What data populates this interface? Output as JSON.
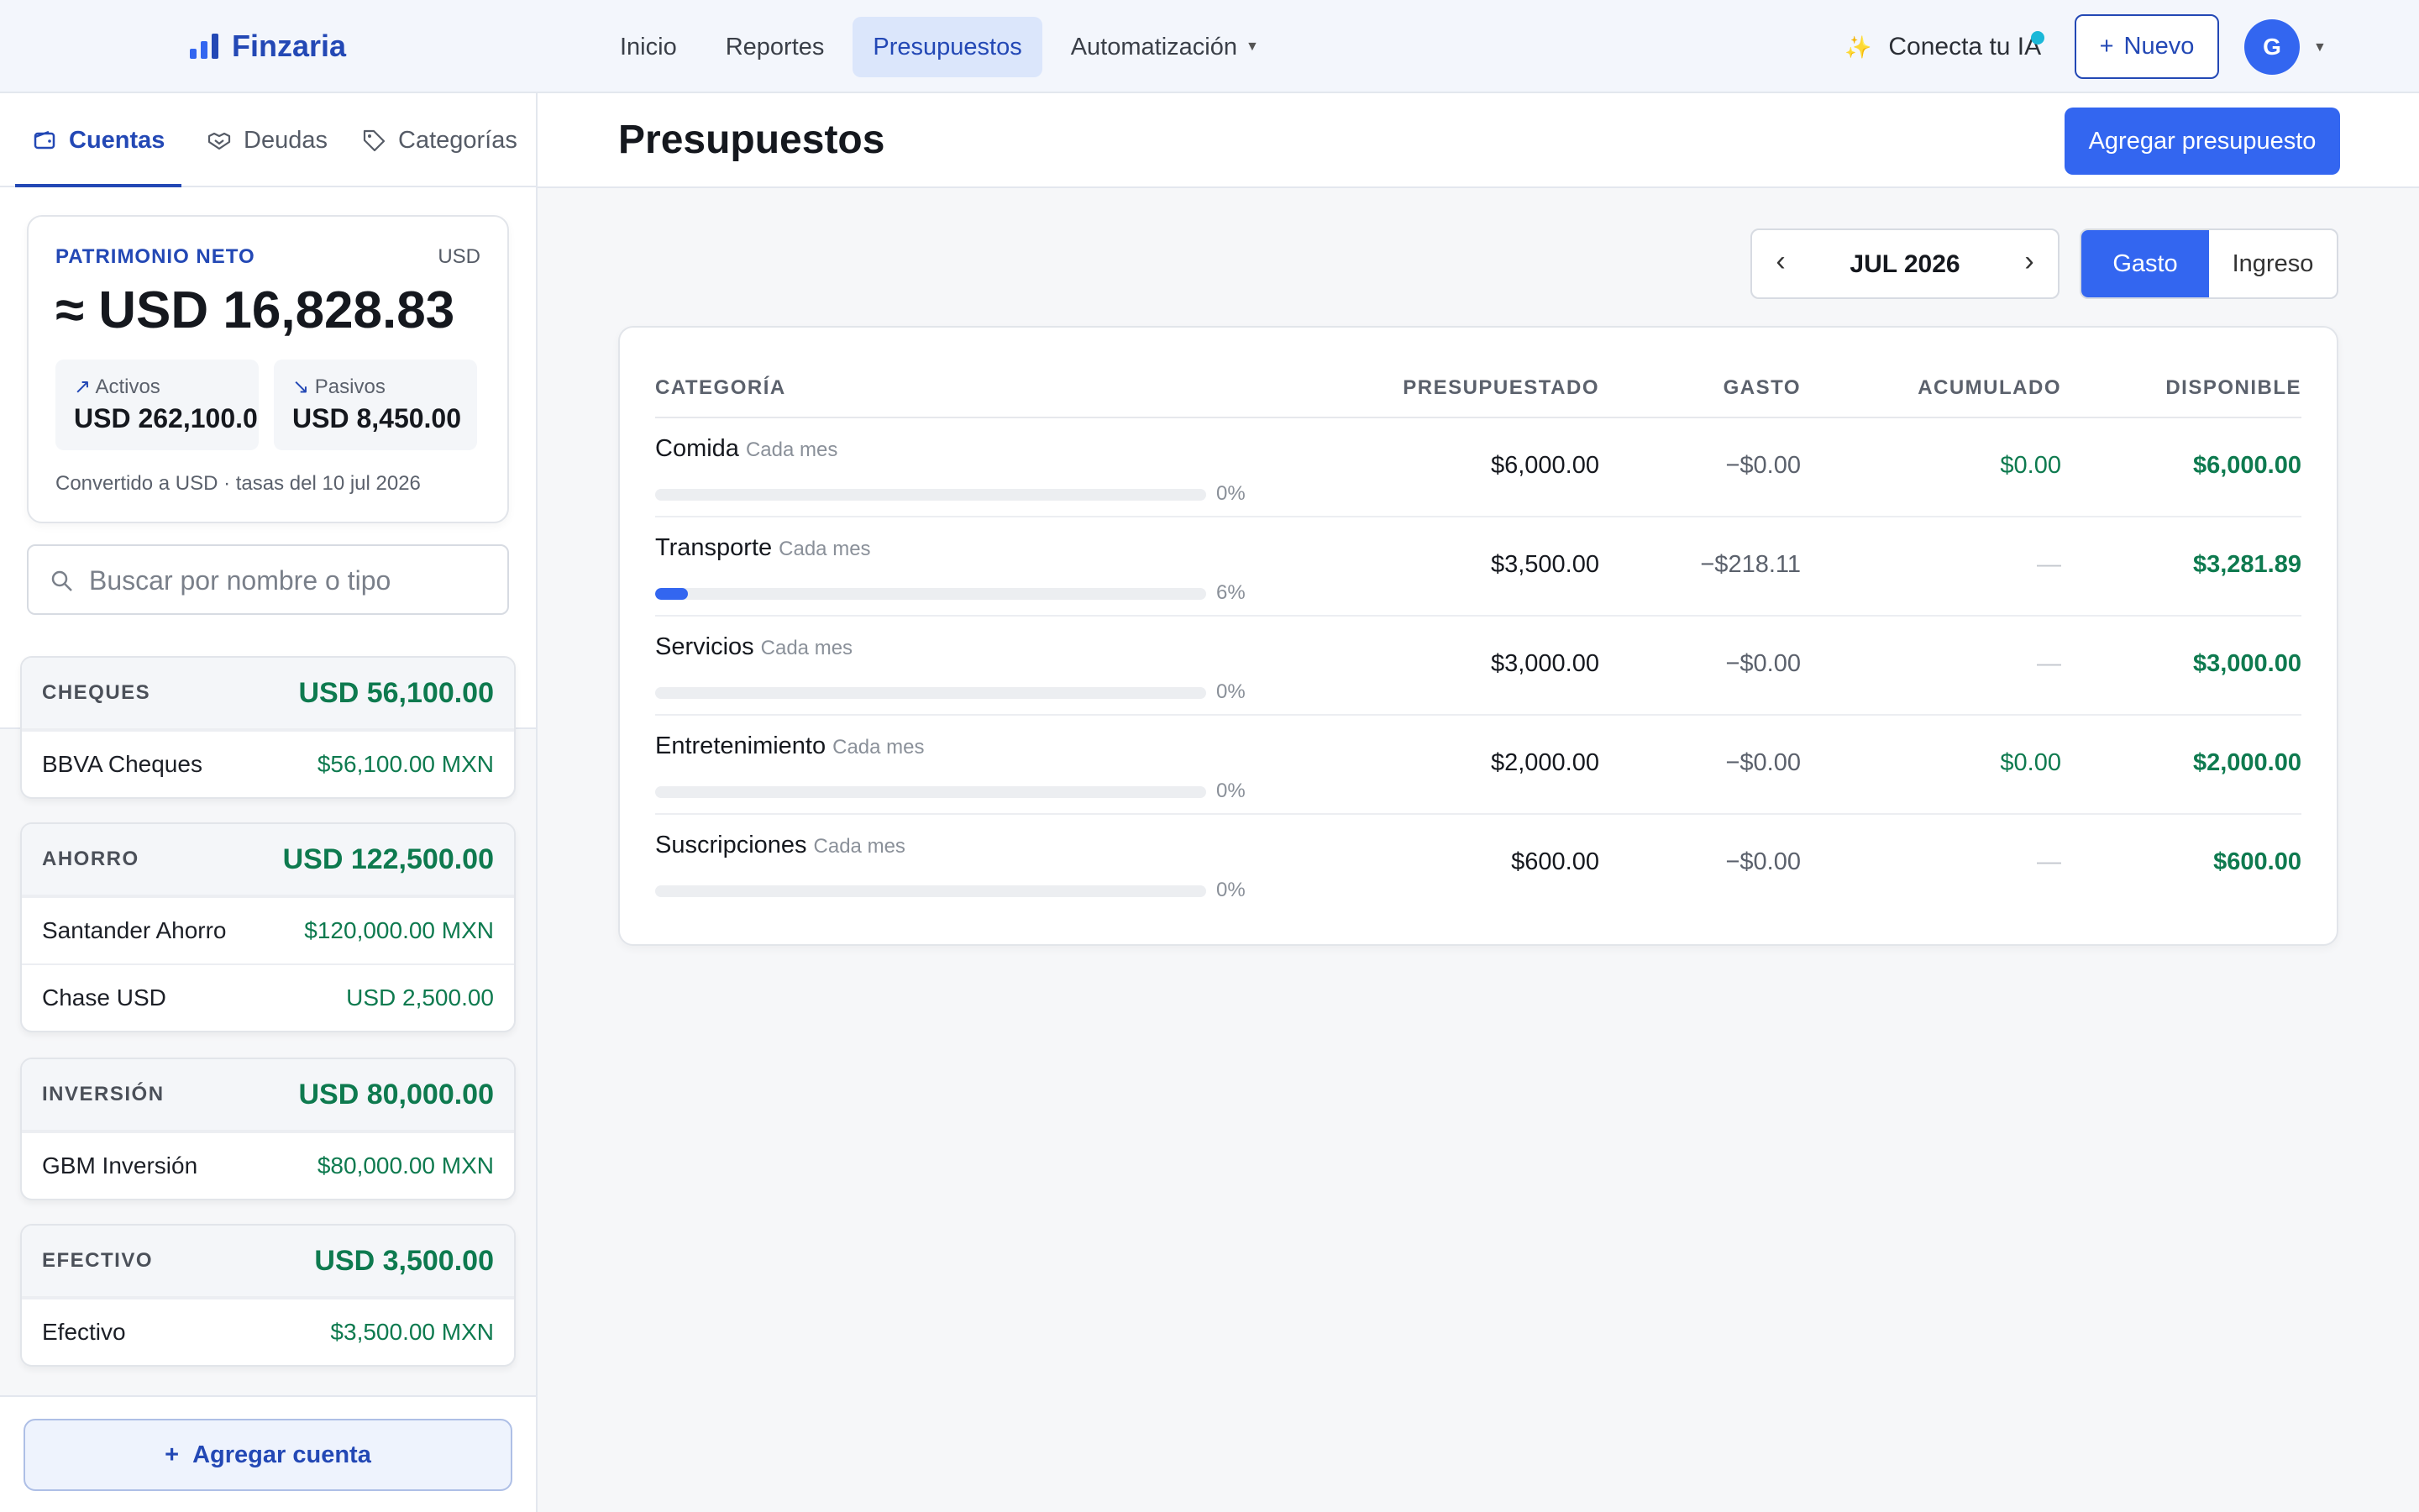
{
  "app": {
    "name": "Finzaria"
  },
  "nav": {
    "items": [
      {
        "label": "Inicio"
      },
      {
        "label": "Reportes"
      },
      {
        "label": "Presupuestos"
      },
      {
        "label": "Automatización"
      }
    ],
    "ai_label": "Conecta tu IA",
    "new_label": "Nuevo",
    "avatar_initial": "G"
  },
  "sidebar": {
    "tabs": [
      {
        "label": "Cuentas"
      },
      {
        "label": "Deudas"
      },
      {
        "label": "Categorías"
      }
    ],
    "networth": {
      "label": "PATRIMONIO NETO",
      "currency": "USD",
      "total": "≈ USD 16,828.83",
      "assets_label": "Activos",
      "assets_value": "USD 262,100.0",
      "liabilities_label": "Pasivos",
      "liabilities_value": "USD 8,450.00",
      "note": "Convertido a USD · tasas del 10 jul 2026"
    },
    "search_placeholder": "Buscar por nombre o tipo",
    "groups": [
      {
        "name": "CHEQUES",
        "total": "USD 56,100.00",
        "accounts": [
          {
            "name": "BBVA Cheques",
            "amount": "$56,100.00 MXN"
          }
        ]
      },
      {
        "name": "AHORRO",
        "total": "USD 122,500.00",
        "accounts": [
          {
            "name": "Santander Ahorro",
            "amount": "$120,000.00 MXN"
          },
          {
            "name": "Chase USD",
            "amount": "USD 2,500.00"
          }
        ]
      },
      {
        "name": "INVERSIÓN",
        "total": "USD 80,000.00",
        "accounts": [
          {
            "name": "GBM Inversión",
            "amount": "$80,000.00 MXN"
          }
        ]
      },
      {
        "name": "EFECTIVO",
        "total": "USD 3,500.00",
        "accounts": [
          {
            "name": "Efectivo",
            "amount": "$3,500.00 MXN"
          }
        ]
      }
    ],
    "add_account_label": "Agregar cuenta"
  },
  "main": {
    "title": "Presupuestos",
    "add_budget_label": "Agregar presupuesto",
    "month": "JUL 2026",
    "type_options": [
      "Gasto",
      "Ingreso"
    ],
    "columns": {
      "category": "CATEGORÍA",
      "budgeted": "PRESUPUESTADO",
      "spent": "GASTO",
      "accumulated": "ACUMULADO",
      "available": "DISPONIBLE"
    },
    "rows": [
      {
        "category": "Comida",
        "frequency": "Cada mes",
        "progress": 0,
        "pct_label": "0%",
        "budgeted": "$6,000.00",
        "spent": "−$0.00",
        "accumulated": "$0.00",
        "available": "$6,000.00"
      },
      {
        "category": "Transporte",
        "frequency": "Cada mes",
        "progress": 6,
        "pct_label": "6%",
        "budgeted": "$3,500.00",
        "spent": "−$218.11",
        "accumulated": "—",
        "available": "$3,281.89"
      },
      {
        "category": "Servicios",
        "frequency": "Cada mes",
        "progress": 0,
        "pct_label": "0%",
        "budgeted": "$3,000.00",
        "spent": "−$0.00",
        "accumulated": "—",
        "available": "$3,000.00"
      },
      {
        "category": "Entretenimiento",
        "frequency": "Cada mes",
        "progress": 0,
        "pct_label": "0%",
        "budgeted": "$2,000.00",
        "spent": "−$0.00",
        "accumulated": "$0.00",
        "available": "$2,000.00"
      },
      {
        "category": "Suscripciones",
        "frequency": "Cada mes",
        "progress": 0,
        "pct_label": "0%",
        "budgeted": "$600.00",
        "spent": "−$0.00",
        "accumulated": "—",
        "available": "$600.00"
      }
    ]
  },
  "colors": {
    "accent": "#3366f0",
    "brand": "#2348b5",
    "positive": "#0e7a4f",
    "ai_dot": "#1bb8d8"
  }
}
